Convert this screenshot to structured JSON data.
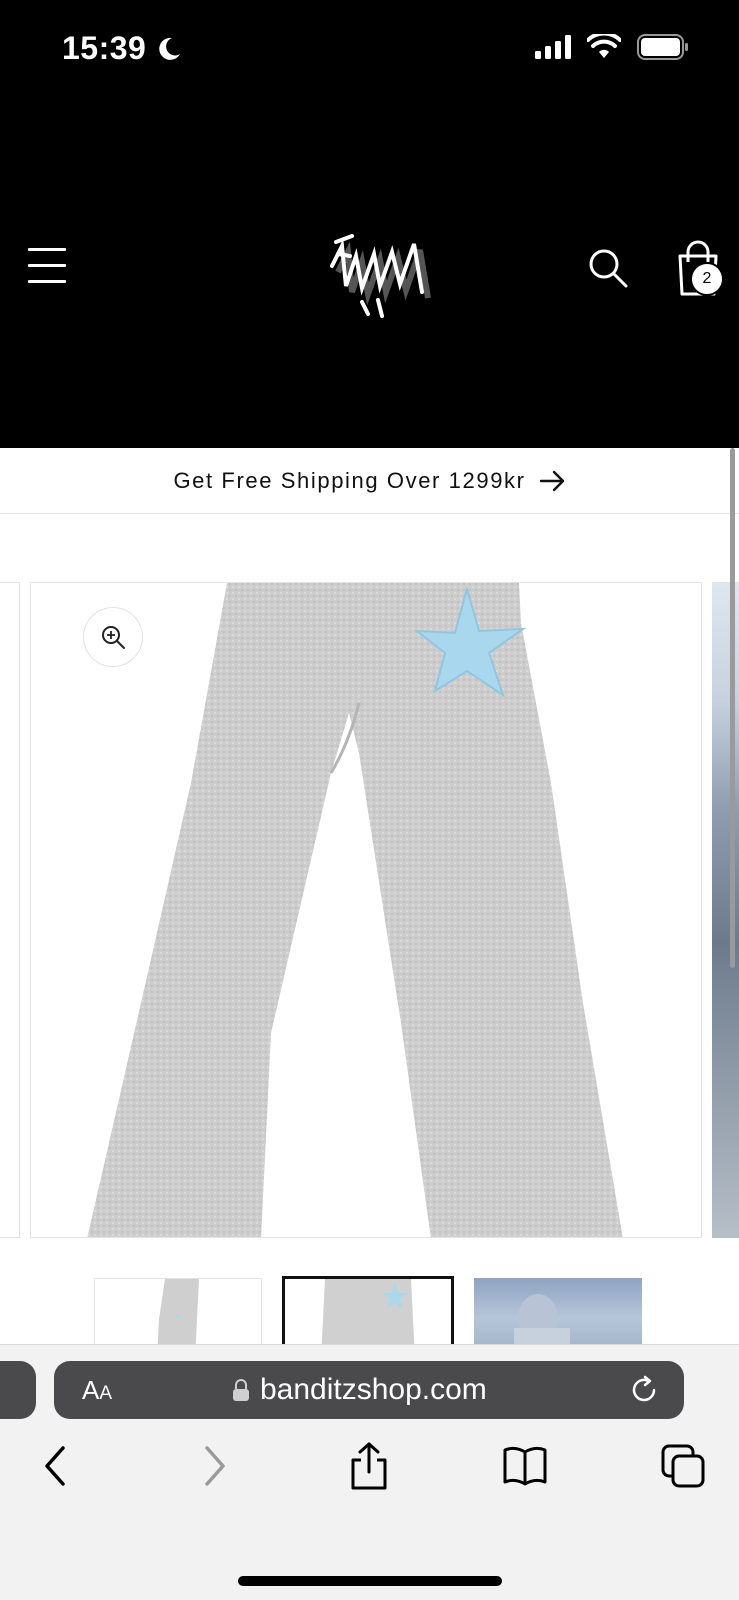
{
  "status_bar": {
    "time": "15:39",
    "icons": [
      "moon-icon",
      "signal-icon",
      "wifi-icon",
      "battery-icon"
    ]
  },
  "header": {
    "menu_icon": "hamburger-icon",
    "logo_alt": "Banditz",
    "search_icon": "search-icon",
    "cart_icon": "shopping-bag-icon",
    "cart_count": "2"
  },
  "announcement": {
    "text": "Get Free Shipping Over 1299kr",
    "arrow_icon": "arrow-right-icon"
  },
  "gallery": {
    "zoom_icon": "zoom-in-icon",
    "active_index": 1,
    "thumbnails": [
      {
        "name": "thumb-sweatpants-front"
      },
      {
        "name": "thumb-sweatpants-back"
      },
      {
        "name": "thumb-hoodie-lifestyle"
      }
    ]
  },
  "browser": {
    "text_size_label": "AA",
    "lock_icon": "lock-icon",
    "url": "banditzshop.com",
    "reload_icon": "reload-icon",
    "nav": [
      "back-icon",
      "forward-icon",
      "share-icon",
      "bookmarks-icon",
      "tabs-icon"
    ]
  },
  "colors": {
    "header_bg": "#000000",
    "accent_star": "#a9d8ee",
    "pants_grey": "#cfcfcf",
    "safari_bar": "#4a4a4c"
  }
}
